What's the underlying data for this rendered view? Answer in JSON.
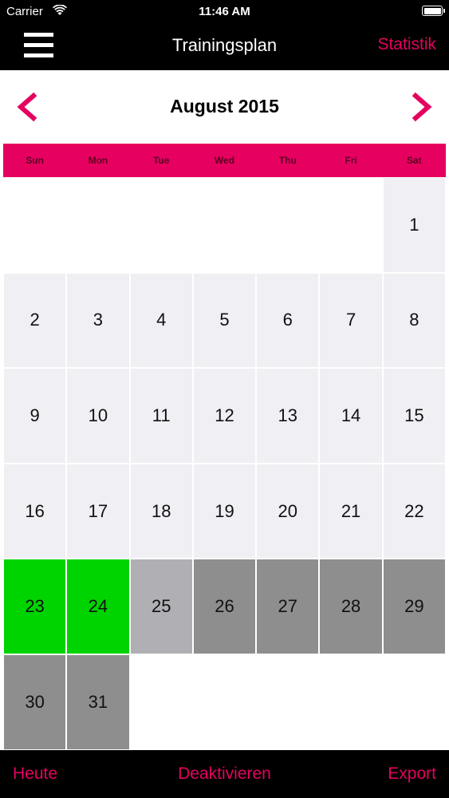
{
  "status_bar": {
    "carrier": "Carrier",
    "time": "11:46 AM"
  },
  "nav": {
    "title": "Trainingsplan",
    "right_label": "Statistik"
  },
  "calendar": {
    "month_title": "August 2015",
    "weekdays": [
      "Sun",
      "Mon",
      "Tue",
      "Wed",
      "Thu",
      "Fri",
      "Sat"
    ],
    "days": [
      "1",
      "2",
      "3",
      "4",
      "5",
      "6",
      "7",
      "8",
      "9",
      "10",
      "11",
      "12",
      "13",
      "14",
      "15",
      "16",
      "17",
      "18",
      "19",
      "20",
      "21",
      "22",
      "23",
      "24",
      "25",
      "26",
      "27",
      "28",
      "29",
      "30",
      "31"
    ],
    "colors": {
      "accent": "#e6005f",
      "green": "#00d400",
      "light_grey": "#b0b0b4",
      "grey": "#8e8e8e",
      "default": "#efeff4"
    }
  },
  "toolbar": {
    "left_label": "Heute",
    "center_label": "Deaktivieren",
    "right_label": "Export"
  },
  "icons": {
    "menu": "hamburger-menu-icon",
    "prev": "chevron-left-icon",
    "next": "chevron-right-icon",
    "wifi": "wifi-icon",
    "battery": "battery-icon"
  }
}
